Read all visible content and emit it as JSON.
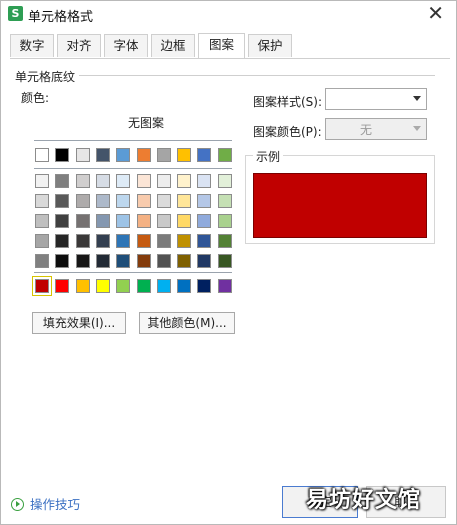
{
  "window": {
    "title": "单元格格式",
    "app_icon_letter": "S",
    "close_glyph": "✕"
  },
  "tabs": [
    {
      "label": "数字"
    },
    {
      "label": "对齐"
    },
    {
      "label": "字体"
    },
    {
      "label": "边框"
    },
    {
      "label": "图案",
      "active": true
    },
    {
      "label": "保护"
    }
  ],
  "shading": {
    "group_label": "单元格底纹",
    "color_label": "颜色:",
    "no_pattern": "无图案",
    "selected_color": "#c00000",
    "palette_top": [
      "#ffffff",
      "#000000",
      "#e7e6e6",
      "#44546a",
      "#5b9bd5",
      "#ed7d31",
      "#a5a5a5",
      "#ffc000",
      "#4472c4",
      "#70ad47"
    ],
    "palette_tints": [
      [
        "#f2f2f2",
        "#7f7f7f",
        "#d0cece",
        "#d6dce5",
        "#deebf7",
        "#fbe5d6",
        "#ededed",
        "#fff2cc",
        "#dae3f3",
        "#e2f0d9"
      ],
      [
        "#d9d9d9",
        "#595959",
        "#aeabab",
        "#adb9ca",
        "#bdd7ee",
        "#f8cbad",
        "#dbdbdb",
        "#ffe699",
        "#b4c7e7",
        "#c5e0b4"
      ],
      [
        "#bfbfbf",
        "#404040",
        "#757171",
        "#8497b0",
        "#9dc3e6",
        "#f4b183",
        "#c9c9c9",
        "#ffd966",
        "#8faadc",
        "#a9d18e"
      ],
      [
        "#a6a6a6",
        "#262626",
        "#3a3838",
        "#333f50",
        "#2e75b6",
        "#c55a11",
        "#7b7b7b",
        "#bf9000",
        "#2f5597",
        "#538135"
      ],
      [
        "#808080",
        "#0d0d0d",
        "#171616",
        "#222a35",
        "#1f4e79",
        "#843c0c",
        "#525252",
        "#7f6000",
        "#203864",
        "#385723"
      ]
    ],
    "palette_standard": [
      "#c00000",
      "#ff0000",
      "#ffc000",
      "#ffff00",
      "#92d050",
      "#00b050",
      "#00b0f0",
      "#0070c0",
      "#002060",
      "#7030a0"
    ],
    "fill_effects_label": "填充效果(I)...",
    "more_colors_label": "其他颜色(M)..."
  },
  "pattern": {
    "style_label": "图案样式(S):",
    "style_value": "",
    "color_label": "图案颜色(P):",
    "color_value": "无"
  },
  "sample": {
    "label": "示例",
    "color": "#c00000"
  },
  "footer": {
    "help_label": "操作技巧",
    "ok_label": "确定",
    "cancel_label": "取消",
    "watermark": "易坊好文馆"
  }
}
